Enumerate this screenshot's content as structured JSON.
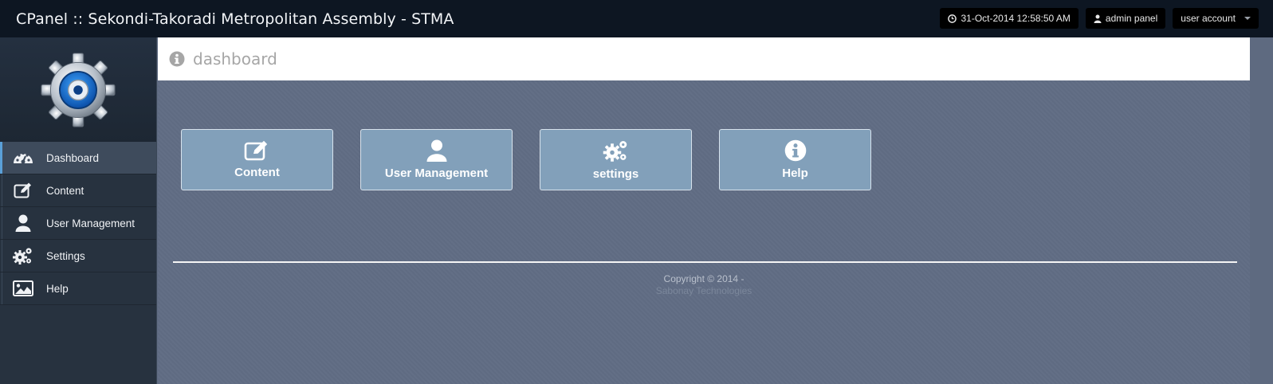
{
  "app": {
    "title": "CPanel :: Sekondi-Takoradi Metropolitan Assembly - STMA"
  },
  "topbar": {
    "datetime": "31-Oct-2014 12:58:50 AM",
    "admin_label": "admin panel",
    "account_label": "user account"
  },
  "sidebar": {
    "items": [
      {
        "label": "Dashboard",
        "icon": "dashboard-icon",
        "active": true
      },
      {
        "label": "Content",
        "icon": "edit-icon"
      },
      {
        "label": "User Management",
        "icon": "user-icon"
      },
      {
        "label": "Settings",
        "icon": "gears-icon"
      },
      {
        "label": "Help",
        "icon": "picture-icon"
      }
    ]
  },
  "header": {
    "title": "dashboard",
    "icon": "info-icon"
  },
  "tiles": [
    {
      "label": "Content",
      "icon": "edit-icon"
    },
    {
      "label": "User Management",
      "icon": "user-icon"
    },
    {
      "label": "settings",
      "icon": "gears-icon"
    },
    {
      "label": "Help",
      "icon": "info-icon"
    }
  ],
  "footer": {
    "copyright": "Copyright © 2014 -",
    "company": "Sabonay Technologies"
  },
  "colors": {
    "topbar": "#0d1622",
    "sidebar": "#27323f",
    "main": "#5f6b82",
    "tile": "#82a0ba",
    "active_accent": "#5aa0d8"
  }
}
